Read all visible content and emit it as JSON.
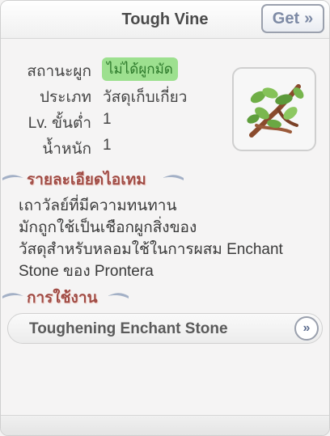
{
  "header": {
    "title": "Tough Vine",
    "get_label": "Get",
    "get_icon": "double-chevron-right-icon"
  },
  "info": {
    "binding_label": "สถานะผูก",
    "binding_value": "ไม่ได้ผูกมัด",
    "type_label": "ประเภท",
    "type_value": "วัสดุเก็บเกี่ยว",
    "level_label": "Lv. ขั้นต่ำ",
    "level_value": "1",
    "weight_label": "น้ำหนัก",
    "weight_value": "1"
  },
  "item_icon": "vine-leaves-icon",
  "details": {
    "title": "รายละเอียดไอเทม",
    "lines": [
      "เถาวัลย์ที่มีความทนทาน",
      "มักถูกใช้เป็นเชือกผูกสิ่งของ",
      "วัสดุสำหรับหลอมใช้ในการผสม Enchant",
      "Stone ของ Prontera"
    ]
  },
  "usage": {
    "title": "การใช้งาน",
    "item_label": "Toughening Enchant Stone",
    "go_icon": "double-chevron-right-icon"
  },
  "colors": {
    "badge_bg": "#9de08f",
    "section_title": "#a04b44",
    "accent_blue": "#7d8aa5"
  }
}
